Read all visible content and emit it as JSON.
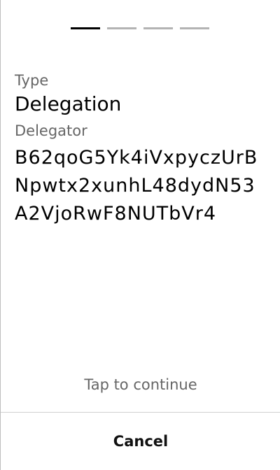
{
  "pager": {
    "total_pages": 4,
    "current_page": 1
  },
  "fields": {
    "type_label": "Type",
    "type_value": "Delegation",
    "delegator_label": "Delegator",
    "delegator_value": "B62qoG5Yk4iVxpyczUrBNpwtx2xunhL48dydN53A2VjoRwF8NUTbVr4"
  },
  "hint": "Tap to continue",
  "actions": {
    "cancel_label": "Cancel"
  },
  "colors": {
    "active_indicator": "#000000",
    "inactive_indicator": "#b3b3b3",
    "muted_text": "#666666"
  }
}
